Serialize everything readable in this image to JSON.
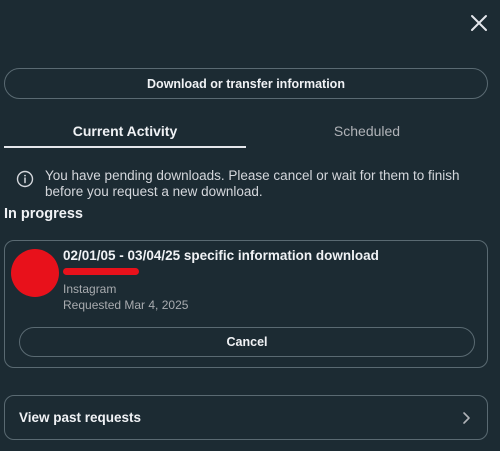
{
  "header": {
    "close_icon": "close-icon"
  },
  "actions": {
    "download_label": "Download or transfer information"
  },
  "tabs": [
    {
      "label": "Current Activity",
      "active": true
    },
    {
      "label": "Scheduled",
      "active": false
    }
  ],
  "notice": {
    "icon": "info-icon",
    "text": "You have pending downloads. Please cancel or wait for them to finish before you request a new download."
  },
  "in_progress": {
    "title": "In progress",
    "item": {
      "title": "02/01/05 - 03/04/25 specific information download",
      "source": "Instagram",
      "requested": "Requested Mar 4, 2025",
      "cancel_label": "Cancel"
    }
  },
  "past": {
    "label": "View past requests",
    "icon": "chevron-right-icon"
  },
  "colors": {
    "background": "#1c2b33",
    "border": "#5a6a72",
    "text": "#f0f2f5",
    "muted_text": "#a8abaf",
    "redaction": "#e8111b"
  }
}
